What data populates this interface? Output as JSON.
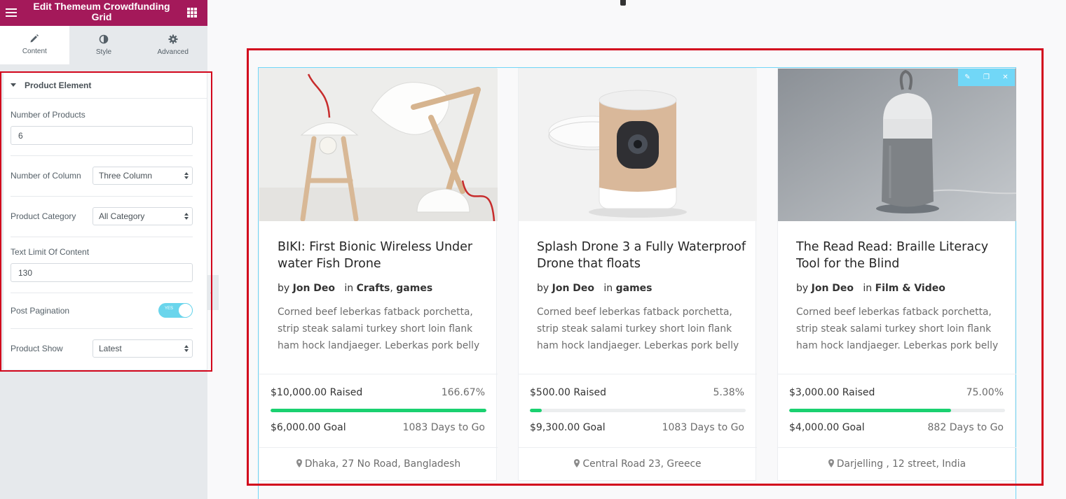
{
  "panel": {
    "title": "Edit Themeum Crowdfunding Grid",
    "tabs": [
      {
        "label": "Content",
        "icon": "pencil-icon"
      },
      {
        "label": "Style",
        "icon": "half-circle-icon"
      },
      {
        "label": "Advanced",
        "icon": "gear-icon"
      }
    ],
    "section_title": "Product Element",
    "controls": {
      "num_products": {
        "label": "Number of Products",
        "value": "6"
      },
      "num_columns": {
        "label": "Number of Column",
        "value": "Three Column"
      },
      "category": {
        "label": "Product Category",
        "value": "All Category"
      },
      "text_limit": {
        "label": "Text Limit Of Content",
        "value": "130"
      },
      "pagination": {
        "label": "Post Pagination",
        "toggle_text": "YES",
        "on": true
      },
      "product_show": {
        "label": "Product Show",
        "value": "Latest"
      }
    }
  },
  "colors": {
    "brand": "#a4195a",
    "accent": "#71d7f7",
    "progress": "#1ad170",
    "highlight": "#d2061c"
  },
  "products": [
    {
      "title": "BIKI: First Bionic Wireless Under water Fish Drone",
      "by": "by",
      "author": "Jon Deo",
      "in": "in",
      "categories": "Crafts, games",
      "cat1": "Crafts",
      "cat_sep": ", ",
      "cat2": "games",
      "desc": "Corned beef leberkas fatback porchetta, strip steak salami turkey short loin flank ham hock landjaeger. Leberkas pork belly",
      "raised": "$10,000.00 Raised",
      "percent": "166.67%",
      "progress": 1.0,
      "goal": "$6,000.00 Goal",
      "days": "1083 Days to Go",
      "location": "Dhaka, 27 No Road, Bangladesh"
    },
    {
      "title": "Splash Drone 3 a Fully Waterproof Drone that floats",
      "by": "by",
      "author": "Jon Deo",
      "in": "in",
      "cat1": "games",
      "cat_sep": "",
      "cat2": "",
      "desc": "Corned beef leberkas fatback porchetta, strip steak salami turkey short loin flank ham hock landjaeger. Leberkas pork belly",
      "raised": "$500.00 Raised",
      "percent": "5.38%",
      "progress": 0.0538,
      "goal": "$9,300.00 Goal",
      "days": "1083 Days to Go",
      "location": "Central Road 23, Greece"
    },
    {
      "title": "The Read Read: Braille Literacy Tool for the Blind",
      "by": "by",
      "author": "Jon Deo",
      "in": "in",
      "cat1": "Film & Video",
      "cat_sep": "",
      "cat2": "",
      "desc": "Corned beef leberkas fatback porchetta, strip steak salami turkey short loin flank ham hock landjaeger. Leberkas pork belly",
      "raised": "$3,000.00 Raised",
      "percent": "75.00%",
      "progress": 0.75,
      "goal": "$4,000.00 Goal",
      "days": "882 Days to Go",
      "location": "Darjelling , 12 street, India"
    }
  ]
}
